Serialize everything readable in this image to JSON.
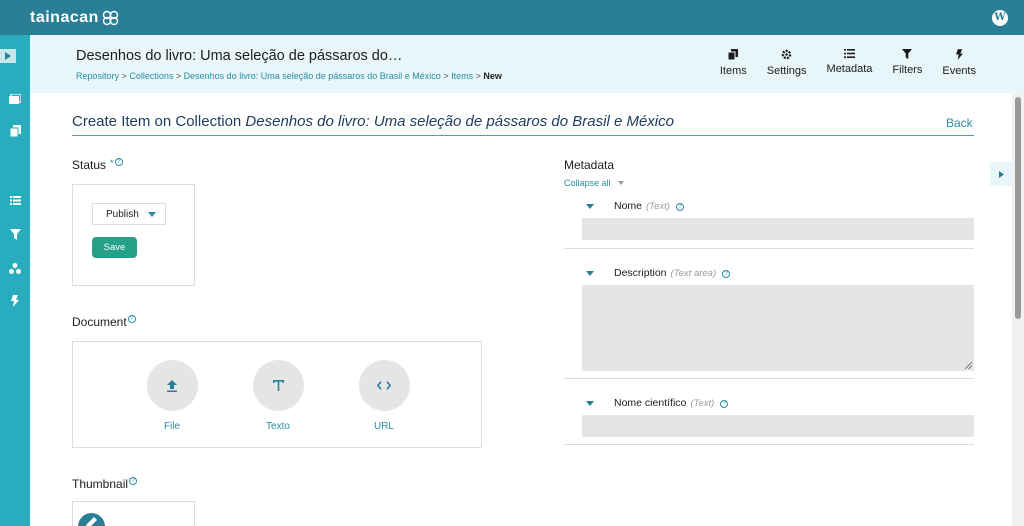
{
  "topbar": {
    "logo_text": "tainacan",
    "wordpress_icon": "wordpress-icon"
  },
  "sidebar": {
    "toggle_icon": "chevron-right-icon",
    "items": [
      {
        "icon": "collections-icon"
      },
      {
        "icon": "items-icon"
      },
      {
        "icon": "metadata-icon"
      },
      {
        "icon": "filters-icon"
      },
      {
        "icon": "taxonomies-icon"
      },
      {
        "icon": "events-icon"
      }
    ]
  },
  "header": {
    "collection_title": "Desenhos do livro: Uma seleção de pássaros do…",
    "breadcrumb": {
      "repository": "Repository",
      "collections": "Collections",
      "collection": "Desenhos do livro: Uma seleção de pássaros do Brasil e México",
      "items": "Items",
      "current": "New",
      "separator": ">"
    },
    "nav": {
      "items": "Items",
      "settings": "Settings",
      "metadata": "Metadata",
      "filters": "Filters",
      "events": "Events"
    }
  },
  "page": {
    "title_prefix": "Create Item on Collection",
    "title_collection": "Desenhos do livro: Uma seleção de pássaros do Brasil e México",
    "back": "Back"
  },
  "status": {
    "label": "Status",
    "required_mark": "*",
    "selected": "Publish",
    "save_label": "Save"
  },
  "document": {
    "label": "Document",
    "options": {
      "file": "File",
      "text": "Texto",
      "url": "URL"
    }
  },
  "thumbnail": {
    "label": "Thumbnail"
  },
  "metadata": {
    "title": "Metadata",
    "collapse_all": "Collapse all",
    "fields": {
      "nome": {
        "name": "Nome",
        "type": "(Text)",
        "value": ""
      },
      "description": {
        "name": "Description",
        "type": "(Text area)",
        "value": ""
      },
      "nome_cientifico": {
        "name": "Nome científico",
        "type": "(Text)",
        "value": ""
      }
    }
  },
  "colors": {
    "topbar": "#2a7f96",
    "sidebar": "#2aacbf",
    "header_bg": "#e8f6f9",
    "accent": "#2a8ea3",
    "save_button": "#25a189"
  }
}
